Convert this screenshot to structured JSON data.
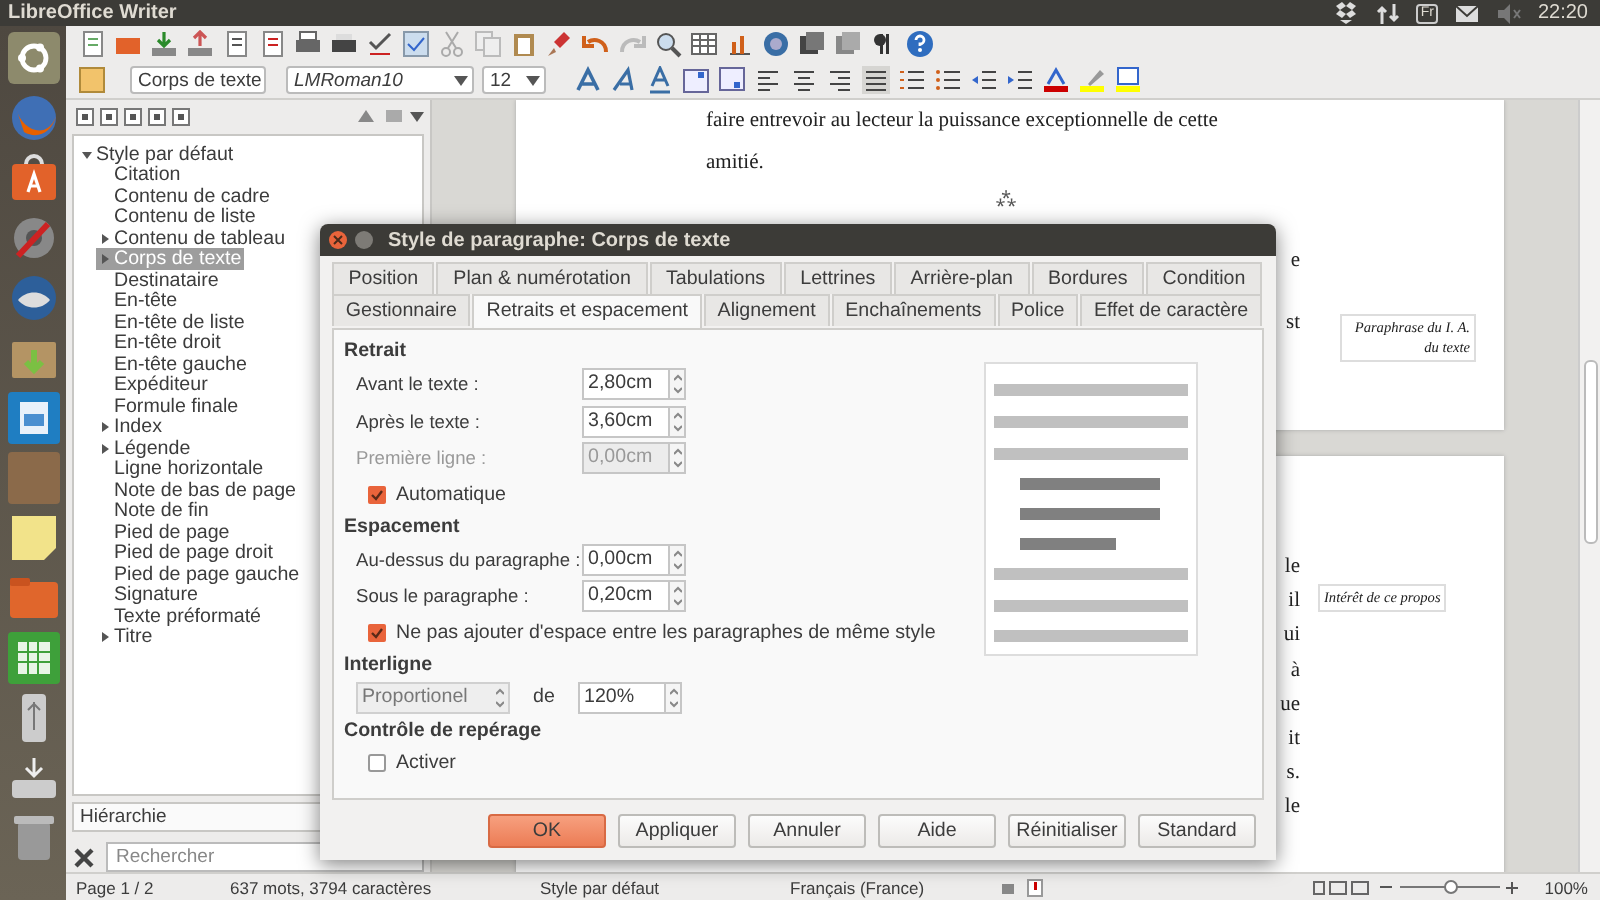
{
  "topbar": {
    "title": "LibreOffice Writer",
    "keyboard_layout": "Fr",
    "clock": "22:20"
  },
  "format_toolbar": {
    "paragraph_style": "Corps de texte",
    "font": "LMRoman10",
    "size": "12"
  },
  "sidebar": {
    "items": [
      {
        "label": "Style par défaut",
        "kind": "branch",
        "expanded": true,
        "selected": false,
        "children": [
          {
            "label": "Citation",
            "kind": "leaf",
            "selected": false
          },
          {
            "label": "Contenu de cadre",
            "kind": "leaf",
            "selected": false
          },
          {
            "label": "Contenu de liste",
            "kind": "leaf",
            "selected": false
          },
          {
            "label": "Contenu de tableau",
            "kind": "branch",
            "expanded": false,
            "selected": false
          },
          {
            "label": "Corps de texte",
            "kind": "branch",
            "expanded": false,
            "selected": true
          },
          {
            "label": "Destinataire",
            "kind": "leaf",
            "selected": false
          },
          {
            "label": "En-tête",
            "kind": "leaf",
            "selected": false
          },
          {
            "label": "En-tête de liste",
            "kind": "leaf",
            "selected": false
          },
          {
            "label": "En-tête droit",
            "kind": "leaf",
            "selected": false
          },
          {
            "label": "En-tête gauche",
            "kind": "leaf",
            "selected": false
          },
          {
            "label": "Expéditeur",
            "kind": "leaf",
            "selected": false
          },
          {
            "label": "Formule finale",
            "kind": "leaf",
            "selected": false
          },
          {
            "label": "Index",
            "kind": "branch",
            "expanded": false,
            "selected": false
          },
          {
            "label": "Légende",
            "kind": "branch",
            "expanded": false,
            "selected": false
          },
          {
            "label": "Ligne horizontale",
            "kind": "leaf",
            "selected": false
          },
          {
            "label": "Note de bas de page",
            "kind": "leaf",
            "selected": false
          },
          {
            "label": "Note de fin",
            "kind": "leaf",
            "selected": false
          },
          {
            "label": "Pied de page",
            "kind": "leaf",
            "selected": false
          },
          {
            "label": "Pied de page droit",
            "kind": "leaf",
            "selected": false
          },
          {
            "label": "Pied de page gauche",
            "kind": "leaf",
            "selected": false
          },
          {
            "label": "Signature",
            "kind": "leaf",
            "selected": false
          },
          {
            "label": "Texte préformaté",
            "kind": "leaf",
            "selected": false
          },
          {
            "label": "Titre",
            "kind": "branch",
            "expanded": false,
            "selected": false
          }
        ]
      }
    ],
    "filter": "Hiérarchie",
    "search": {
      "placeholder": "Rechercher"
    }
  },
  "document": {
    "pages": [
      {
        "lines": [
          "faire entrevoir au lecteur la puissance exceptionnelle de cette",
          "amitié."
        ],
        "ornament": "⁂",
        "line_ends": [
          "e",
          "st"
        ],
        "margin_notes": [
          "Paraphrase du I. A. du texte"
        ]
      },
      {
        "line_ends": [
          "le",
          "il",
          "ui",
          "à",
          "ue",
          "it",
          "s.",
          "le"
        ],
        "margin_notes": [
          "Intérêt de ce propos"
        ]
      }
    ]
  },
  "dialog": {
    "title": "Style de paragraphe: Corps de texte",
    "tab_rows": [
      {
        "tabs": [
          {
            "label": "Position",
            "selected": false
          },
          {
            "label": "Plan & numérotation",
            "selected": false
          },
          {
            "label": "Tabulations",
            "selected": false
          },
          {
            "label": "Lettrines",
            "selected": false
          },
          {
            "label": "Arrière-plan",
            "selected": false
          },
          {
            "label": "Bordures",
            "selected": false
          },
          {
            "label": "Condition",
            "selected": false
          }
        ]
      },
      {
        "tabs": [
          {
            "label": "Gestionnaire",
            "selected": false
          },
          {
            "label": "Retraits et espacement",
            "selected": true
          },
          {
            "label": "Alignement",
            "selected": false
          },
          {
            "label": "Enchaînements",
            "selected": false
          },
          {
            "label": "Police",
            "selected": false
          },
          {
            "label": "Effet de caractère",
            "selected": false
          }
        ]
      }
    ],
    "sections": [
      {
        "title": "Retrait",
        "rows": [
          {
            "kind": "spin",
            "label": "Avant le texte :",
            "value": "2,80cm",
            "disabled": false
          },
          {
            "kind": "spin",
            "label": "Après le texte :",
            "value": "3,60cm",
            "disabled": false
          },
          {
            "kind": "spin",
            "label": "Première ligne :",
            "value": "0,00cm",
            "disabled": true
          },
          {
            "kind": "check",
            "label": "Automatique",
            "checked": true
          }
        ]
      },
      {
        "title": "Espacement",
        "rows": [
          {
            "kind": "spin",
            "label": "Au-dessus du paragraphe :",
            "value": "0,00cm",
            "disabled": false
          },
          {
            "kind": "spin",
            "label": "Sous le paragraphe :",
            "value": "0,20cm",
            "disabled": false
          },
          {
            "kind": "check",
            "label": "Ne pas ajouter d'espace entre les paragraphes de même style",
            "checked": true
          }
        ]
      },
      {
        "title": "Interligne",
        "rows": [
          {
            "kind": "combo",
            "select": "Proportionel",
            "label": "de",
            "value": "120%"
          }
        ]
      },
      {
        "title": "Contrôle de repérage",
        "rows": [
          {
            "kind": "check",
            "label": "Activer",
            "checked": false
          }
        ]
      }
    ],
    "buttons": [
      {
        "label": "OK",
        "default": true
      },
      {
        "label": "Appliquer",
        "default": false
      },
      {
        "label": "Annuler",
        "default": false
      },
      {
        "label": "Aide",
        "default": false
      },
      {
        "label": "Réinitialiser",
        "default": false
      },
      {
        "label": "Standard",
        "default": false
      }
    ]
  },
  "status_bar": {
    "fields": [
      "Page 1 / 2",
      "637 mots, 3794 caractères",
      "Style par défaut",
      "Français (France)"
    ],
    "zoom": {
      "level": 0.5,
      "reading": "100%"
    }
  }
}
